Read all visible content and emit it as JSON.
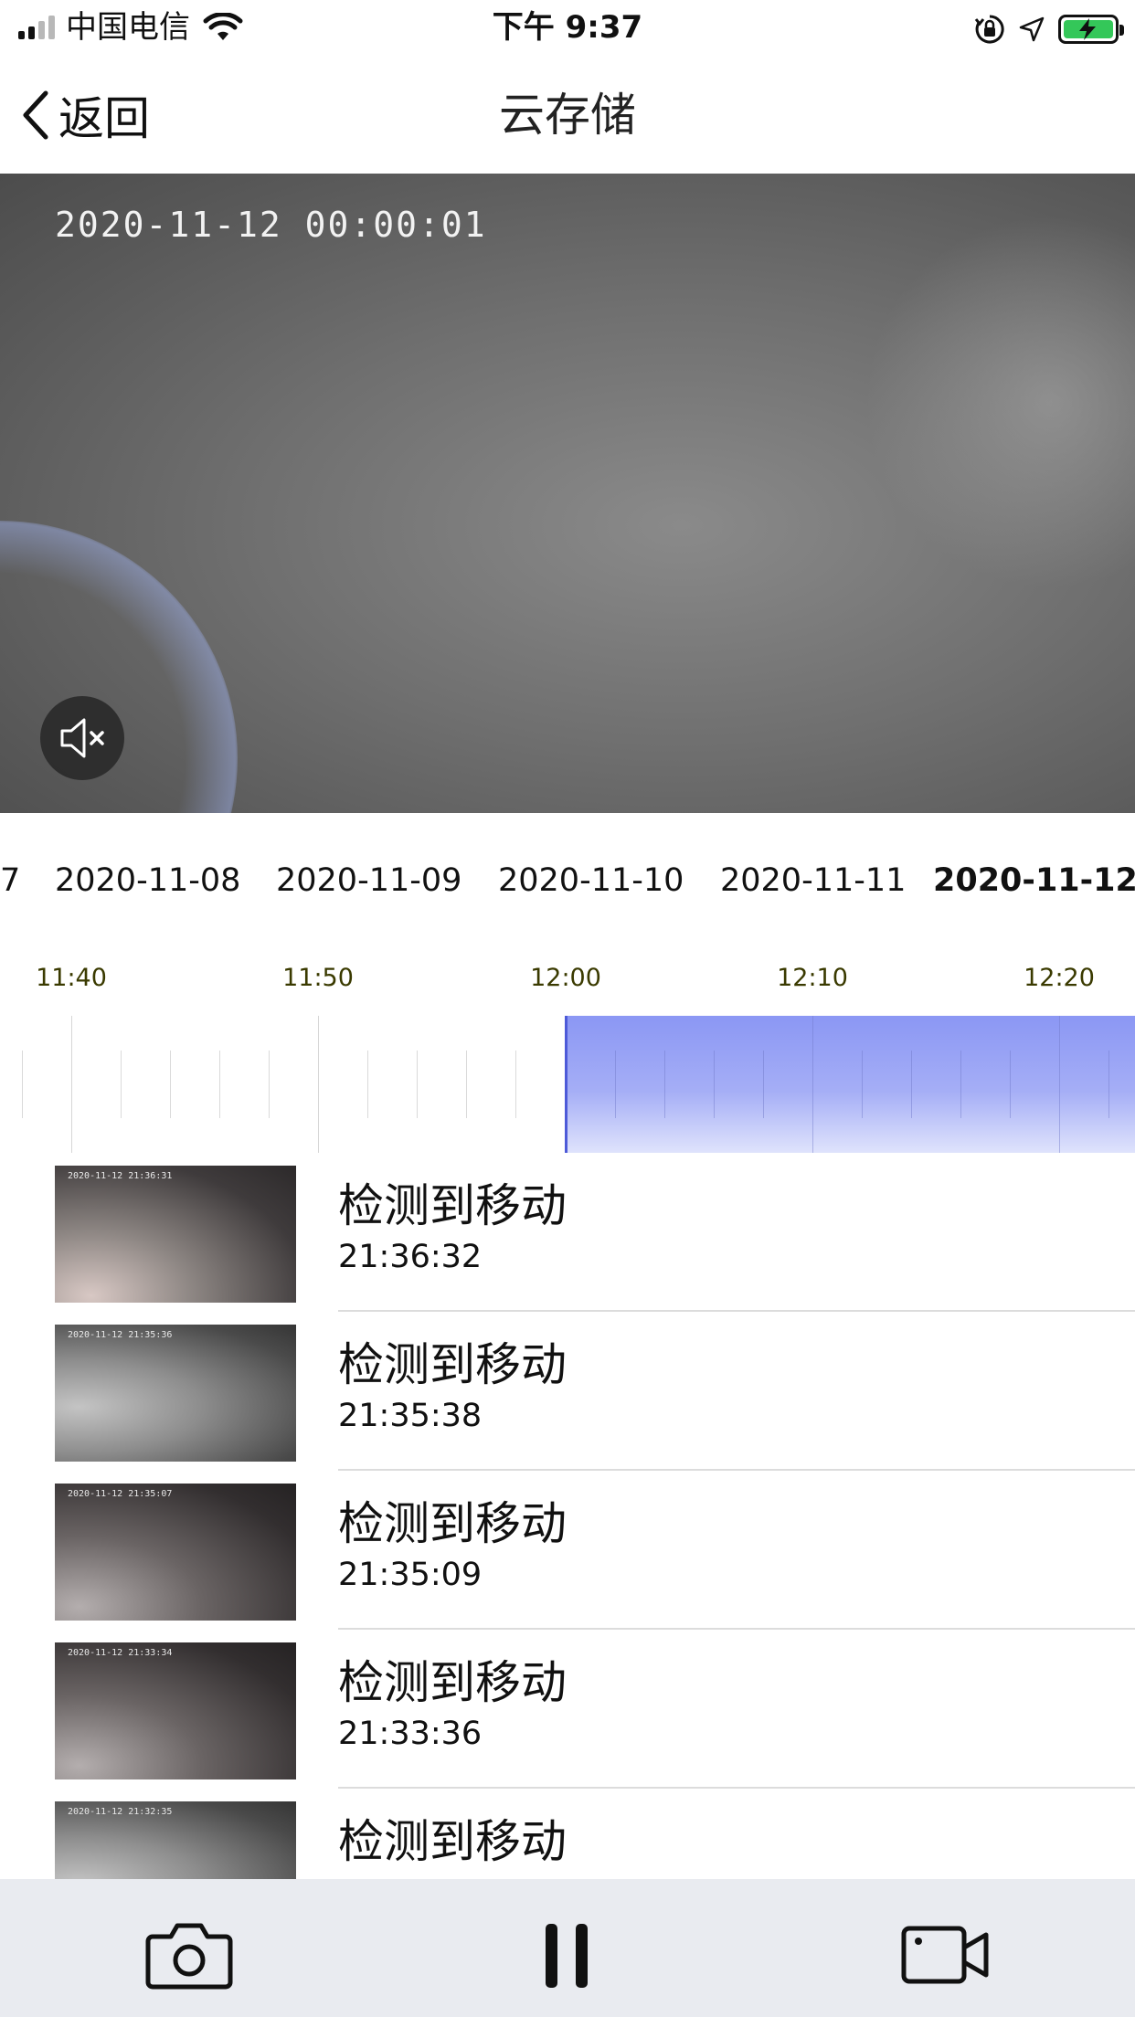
{
  "status_bar": {
    "carrier": "中国电信",
    "time": "下午 9:37",
    "signal_bars": 4,
    "signal_active": 2,
    "battery_color": "#34c759"
  },
  "nav": {
    "back_label": "返回",
    "title": "云存储"
  },
  "video": {
    "timestamp": "2020-11-12  00:00:01",
    "mute_icon": "speaker-muted-icon"
  },
  "dates": [
    {
      "label": "7",
      "active": false
    },
    {
      "label": "2020-11-08",
      "active": false
    },
    {
      "label": "2020-11-09",
      "active": false
    },
    {
      "label": "2020-11-10",
      "active": false
    },
    {
      "label": "2020-11-11",
      "active": false
    },
    {
      "label": "2020-11-12",
      "active": true
    }
  ],
  "timeline": {
    "labels": [
      "11:40",
      "11:50",
      "12:00",
      "12:10",
      "12:20"
    ],
    "accent": "#8b97f4"
  },
  "events": [
    {
      "title": "检测到移动",
      "time": "21:36:32",
      "thumb_timestamp": "2020-11-12 21:36:31",
      "tone": "warm"
    },
    {
      "title": "检测到移动",
      "time": "21:35:38",
      "thumb_timestamp": "2020-11-12 21:35:36",
      "tone": "gray"
    },
    {
      "title": "检测到移动",
      "time": "21:35:09",
      "thumb_timestamp": "2020-11-12 21:35:07",
      "tone": "dark"
    },
    {
      "title": "检测到移动",
      "time": "21:33:36",
      "thumb_timestamp": "2020-11-12 21:33:34",
      "tone": "dark"
    },
    {
      "title": "检测到移动",
      "time": "",
      "thumb_timestamp": "2020-11-12 21:32:35",
      "tone": "gray"
    }
  ],
  "toolbar": {
    "snapshot_icon": "camera-icon",
    "pause_icon": "pause-icon",
    "record_icon": "video-camera-icon"
  }
}
